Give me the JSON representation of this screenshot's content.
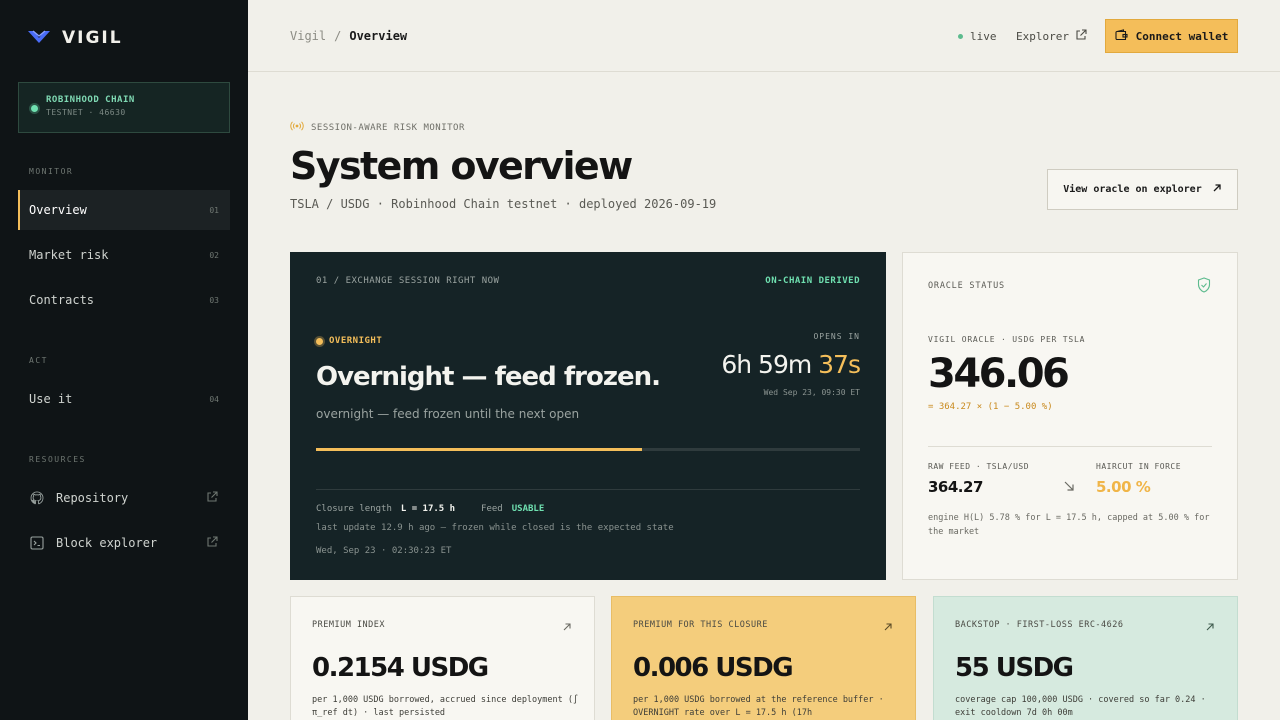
{
  "brand": {
    "name": "VIGIL"
  },
  "chain": {
    "title": "ROBINHOOD CHAIN",
    "subtitle": "TESTNET · 46630"
  },
  "nav": {
    "monitor_label": "MONITOR",
    "act_label": "ACT",
    "resources_label": "RESOURCES",
    "items": [
      {
        "label": "Overview",
        "num": "01"
      },
      {
        "label": "Market risk",
        "num": "02"
      },
      {
        "label": "Contracts",
        "num": "03"
      },
      {
        "label": "Use it",
        "num": "04"
      }
    ],
    "resources": [
      {
        "label": "Repository",
        "icon": "github-icon"
      },
      {
        "label": "Block explorer",
        "icon": "terminal-icon"
      }
    ]
  },
  "topbar": {
    "crumb_root": "Vigil",
    "crumb_sep": "/",
    "crumb_current": "Overview",
    "live": "live",
    "explorer": "Explorer",
    "connect": "Connect wallet"
  },
  "header": {
    "eyebrow": "SESSION-AWARE RISK MONITOR",
    "title": "System overview",
    "subtitle": "TSLA / USDG · Robinhood Chain testnet · deployed 2026-09-19",
    "oracle_button": "View oracle on explorer"
  },
  "session": {
    "label": "01 / EXCHANGE SESSION RIGHT NOW",
    "onchain": "ON-CHAIN DERIVED",
    "badge": "OVERNIGHT",
    "title": "Overnight — feed frozen.",
    "desc": "overnight — feed frozen until the next open",
    "opens_label": "OPENS IN",
    "count_main": "6h 59m ",
    "count_sec": "37s",
    "opens_date": "Wed Sep 23, 09:30 ET",
    "progress": 0.6,
    "closure_label": "Closure length",
    "closure_value": "L = 17.5 h",
    "feed_label": "Feed",
    "feed_value": "USABLE",
    "last_update": "last update 12.9 h ago — frozen while closed is the expected state",
    "timestamp": "Wed, Sep 23 · 02:30:23 ET"
  },
  "oracle": {
    "label": "ORACLE STATUS",
    "sub": "VIGIL ORACLE · USDG PER TSLA",
    "value": "346.06",
    "formula": "= 364.27 × (1 − 5.00 %)",
    "raw_label": "RAW FEED · TSLA/USD",
    "raw_value": "364.27",
    "haircut_label": "HAIRCUT IN FORCE",
    "haircut_value": "5.00 %",
    "note": "engine H(L) 5.78 % for L = 17.5 h, capped at 5.00 % for the market"
  },
  "cards": [
    {
      "label": "PREMIUM INDEX",
      "value": "0.2154 USDG",
      "desc": "per 1,000 USDG borrowed, accrued since deployment (∫ π_ref dt) · last persisted"
    },
    {
      "label": "PREMIUM FOR THIS CLOSURE",
      "value": "0.006 USDG",
      "desc": "per 1,000 USDG borrowed at the reference buffer · OVERNIGHT rate over L = 17.5 h (17h"
    },
    {
      "label": "BACKSTOP · FIRST-LOSS ERC-4626",
      "value": "55 USDG",
      "desc": "coverage cap 100,000 USDG · covered so far 0.24 · exit cooldown 7d 0h 00m"
    }
  ],
  "colors": {
    "accent": "#f4be5a",
    "green": "#6fe0b0",
    "sidebar": "#0f1416",
    "session_bg": "#152326"
  }
}
